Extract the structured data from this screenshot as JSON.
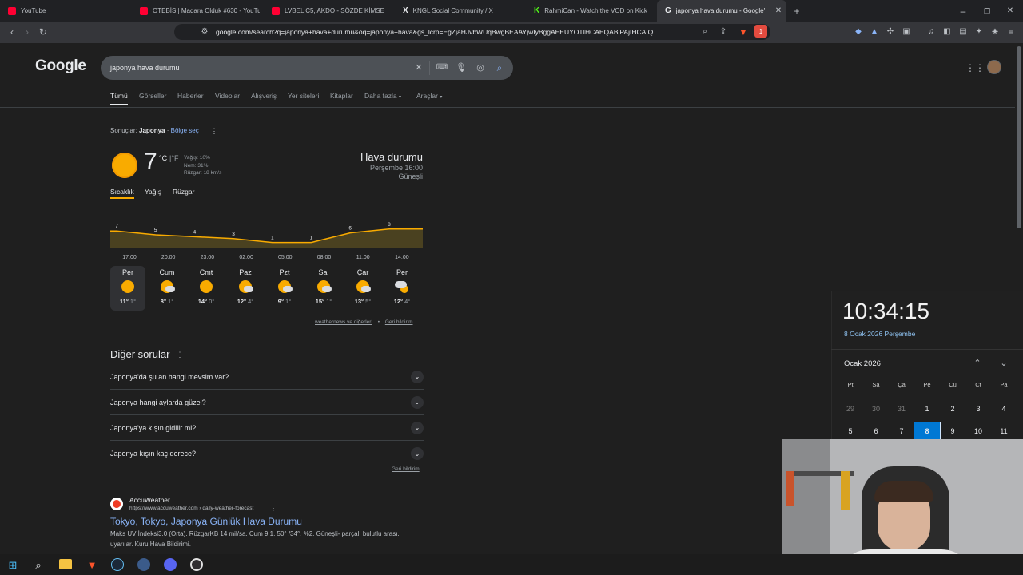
{
  "browser": {
    "tabs": [
      {
        "title": "YouTube",
        "color": "#ff0033"
      },
      {
        "title": "OTEBİS | Madara Olduk #630 - YouTu",
        "color": "#ff0033"
      },
      {
        "title": "LVBEL C5, AKDO - SÖZDE KİMSE",
        "color": "#ff0033"
      },
      {
        "title": "KNGL Social Community / X",
        "color": "#e8eaed"
      },
      {
        "title": "RahmiCan - Watch the VOD on Kick",
        "color": "#53fc18"
      },
      {
        "title": "japonya hava durumu - Google'",
        "color": "#4285f4"
      }
    ],
    "url": "google.com/search?q=japonya+hava+durumu&oq=japonya+hava&gs_lcrp=EgZjaHJvbWUqBwgBEAAYjwIyBggAEEUYOTIHCAEQABiPAjIHCAIQ...",
    "brave_badge": "1"
  },
  "google": {
    "logo": "Google",
    "query": "japonya hava durumu",
    "tabs": [
      "Tümü",
      "Görseller",
      "Haberler",
      "Videolar",
      "Alışveriş",
      "Yer siteleri",
      "Kitaplar",
      "Daha fazla",
      "Araçlar"
    ]
  },
  "weather": {
    "results_prefix": "Sonuçlar:",
    "location": "Japonya",
    "region_link": "Bölge seç",
    "temperature": "7",
    "unit_c": "°C",
    "unit_f": "°F",
    "precip": "Yağış: 10%",
    "humidity": "Nem: 31%",
    "wind": "Rüzgar: 18 km/s",
    "title": "Hava durumu",
    "datetime": "Perşembe 16:00",
    "condition": "Güneşli",
    "tabs": [
      "Sıcaklık",
      "Yağış",
      "Rüzgar"
    ],
    "chart": {
      "hours": [
        "17:00",
        "20:00",
        "23:00",
        "02:00",
        "05:00",
        "08:00",
        "11:00",
        "14:00"
      ],
      "temps": [
        7,
        5,
        4,
        3,
        1,
        1,
        6,
        8
      ]
    },
    "days": [
      {
        "name": "Per",
        "hi": "11°",
        "lo": "1°",
        "icon": "sun"
      },
      {
        "name": "Cum",
        "hi": "8°",
        "lo": "1°",
        "icon": "partly-cloudy"
      },
      {
        "name": "Cmt",
        "hi": "14°",
        "lo": "0°",
        "icon": "sun"
      },
      {
        "name": "Paz",
        "hi": "12°",
        "lo": "4°",
        "icon": "partly-cloudy"
      },
      {
        "name": "Pzt",
        "hi": "9°",
        "lo": "1°",
        "icon": "partly-cloudy"
      },
      {
        "name": "Sal",
        "hi": "15°",
        "lo": "1°",
        "icon": "partly-cloudy"
      },
      {
        "name": "Çar",
        "hi": "13°",
        "lo": "5°",
        "icon": "partly-cloudy"
      },
      {
        "name": "Per",
        "hi": "12°",
        "lo": "4°",
        "icon": "cloudy-sun"
      }
    ],
    "source_link": "weathernews ve diğerleri",
    "feedback": "Geri bildirim"
  },
  "questions": {
    "title": "Diğer sorular",
    "items": [
      "Japonya'da şu an hangi mevsim var?",
      "Japonya hangi aylarda güzel?",
      "Japonya'ya kışın gidilir mi?",
      "Japonya kışın kaç derece?"
    ],
    "feedback": "Geri bildirim"
  },
  "result": {
    "site": "AccuWeather",
    "url": "https://www.accuweather.com › daily-weather-forecast",
    "title": "Tokyo, Tokyo, Japonya Günlük Hava Durumu",
    "snippet1": "Maks UV İndeksi3.0 (Orta). RüzgarKB 14 mil/sa. Cum 9.1. 50° /34°. %2. Güneşli- parçalı bulutlu arası.",
    "snippet2": "uyarılar. Kuru Hava Bildirimi."
  },
  "clock": {
    "time": "10:34:15",
    "date": "8 Ocak 2026 Perşembe",
    "month": "Ocak 2026",
    "weekdays": [
      "Pt",
      "Sa",
      "Ça",
      "Pe",
      "Cu",
      "Ct",
      "Pa"
    ],
    "week1": [
      "29",
      "30",
      "31",
      "1",
      "2",
      "3",
      "4"
    ],
    "week2": [
      "5",
      "6",
      "7",
      "8",
      "9",
      "10",
      "11"
    ],
    "today": "8"
  }
}
